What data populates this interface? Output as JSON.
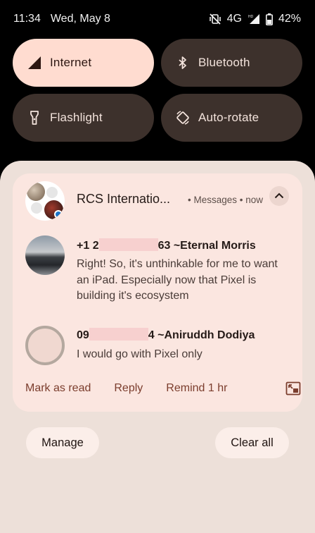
{
  "status_bar": {
    "time": "11:34",
    "date": "Wed, May 8",
    "network": "4G",
    "battery": "42%",
    "icons": [
      "vibrate-off-icon",
      "signal-icon",
      "battery-icon"
    ]
  },
  "quick_tiles": [
    {
      "label": "Internet",
      "icon": "signal-icon",
      "active": true
    },
    {
      "label": "Bluetooth",
      "icon": "bluetooth-icon",
      "active": false
    },
    {
      "label": "Flashlight",
      "icon": "flashlight-icon",
      "active": false
    },
    {
      "label": "Auto-rotate",
      "icon": "rotate-icon",
      "active": false
    }
  ],
  "notification": {
    "title": "RCS Internatio...",
    "app": "Messages",
    "time": "now",
    "messages": [
      {
        "sender_prefix": "+1 2",
        "sender_suffix": "63 ~Eternal Morris",
        "body": "Right! So, it's unthinkable for me to want an iPad. Especially now that Pixel is building it's ecosystem"
      },
      {
        "sender_prefix": "09",
        "sender_suffix": "4 ~Aniruddh Dodiya",
        "body": "I would go with Pixel only"
      }
    ],
    "actions": {
      "mark_read": "Mark as read",
      "reply": "Reply",
      "remind": "Remind 1 hr"
    }
  },
  "footer": {
    "manage": "Manage",
    "clear_all": "Clear all"
  },
  "colors": {
    "active_tile": "#ffdcd0",
    "inactive_tile": "#3d312c",
    "card": "#fbe6e0",
    "action_text": "#7b3d2d"
  }
}
